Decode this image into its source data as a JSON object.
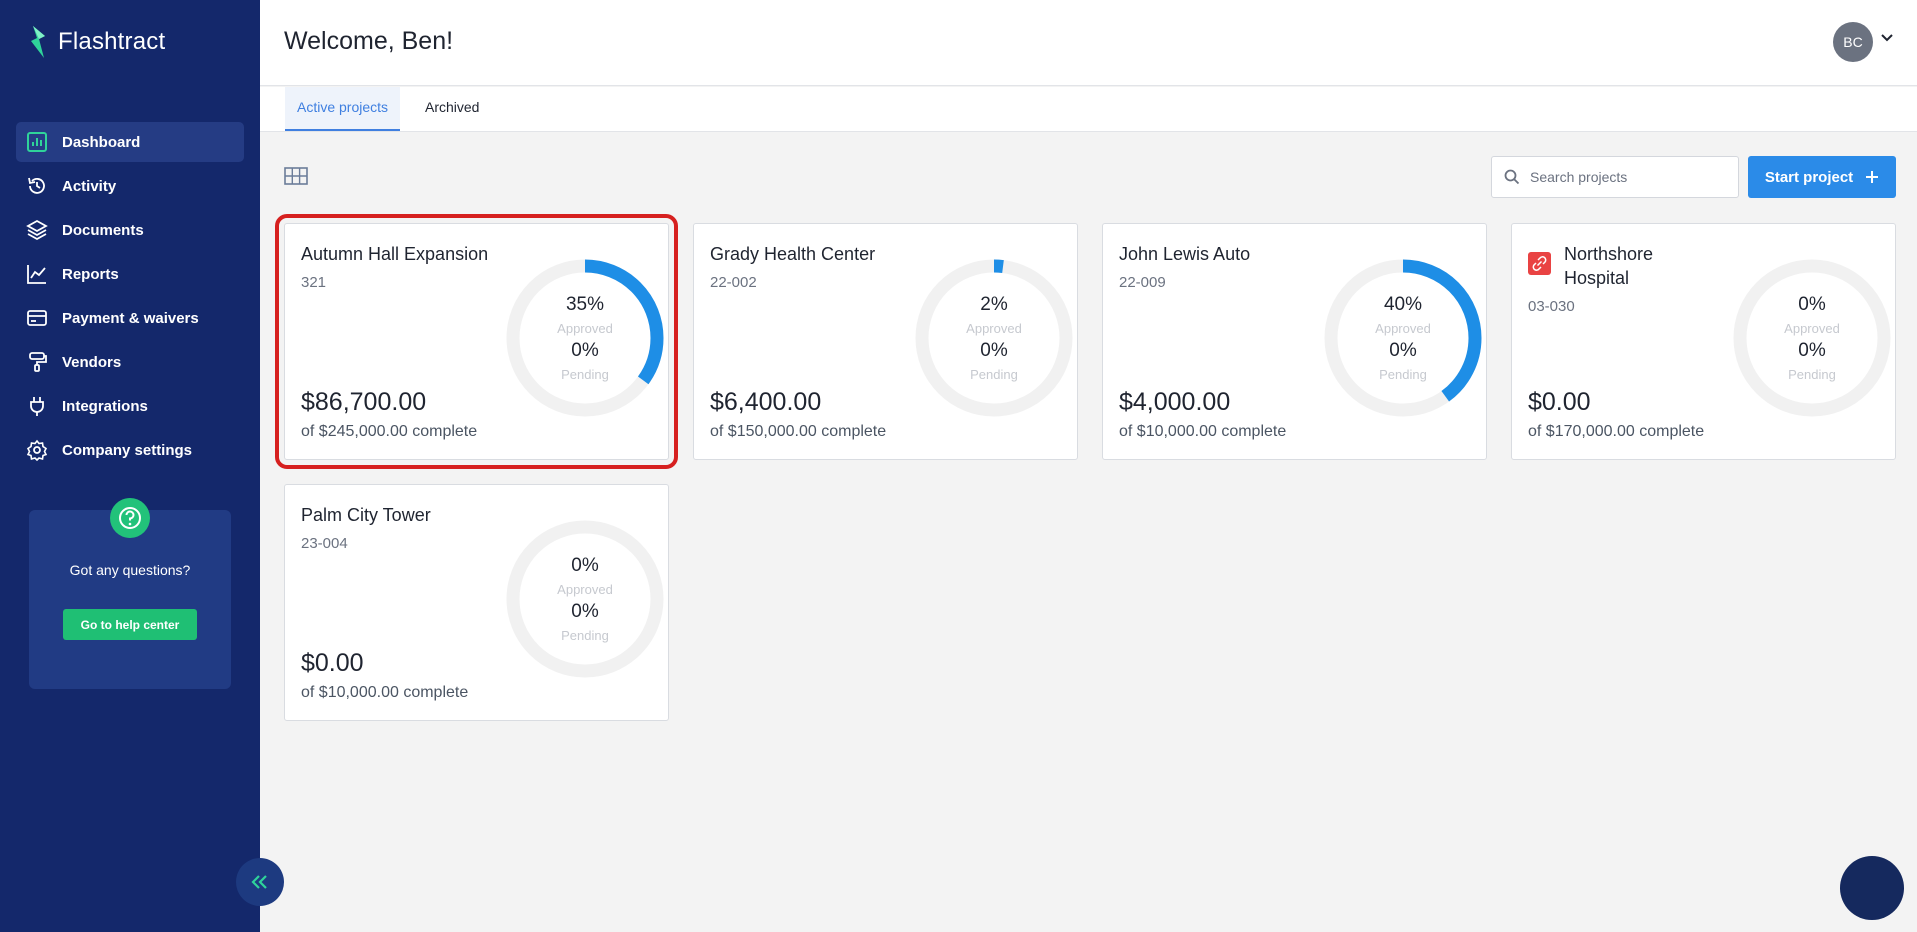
{
  "app": {
    "name": "Flashtract"
  },
  "sidebar": {
    "items": [
      {
        "label": "Dashboard",
        "icon": "chart-bar-icon",
        "active": true
      },
      {
        "label": "Activity",
        "icon": "history-icon",
        "active": false
      },
      {
        "label": "Documents",
        "icon": "layers-icon",
        "active": false
      },
      {
        "label": "Reports",
        "icon": "line-chart-icon",
        "active": false
      },
      {
        "label": "Payment & waivers",
        "icon": "credit-card-icon",
        "active": false
      },
      {
        "label": "Vendors",
        "icon": "brush-icon",
        "active": false
      },
      {
        "label": "Integrations",
        "icon": "plug-icon",
        "active": false
      },
      {
        "label": "Company settings",
        "icon": "gear-icon",
        "active": false
      }
    ],
    "help": {
      "text": "Got any questions?",
      "button": "Go to help center"
    }
  },
  "header": {
    "welcome": "Welcome, Ben!",
    "avatar_initials": "BC"
  },
  "tabs": [
    {
      "label": "Active projects",
      "active": true
    },
    {
      "label": "Archived",
      "active": false
    }
  ],
  "toolbar": {
    "search_placeholder": "Search projects",
    "start_label": "Start project"
  },
  "labels": {
    "approved": "Approved",
    "pending": "Pending"
  },
  "projects": [
    {
      "name": "Autumn Hall Expansion",
      "code": "321",
      "amount": "$86,700.00",
      "of": "of $245,000.00 complete",
      "approved_pct": 35,
      "approved": "35%",
      "pending": "0%",
      "selected": true
    },
    {
      "name": "Grady Health Center",
      "code": "22-002",
      "amount": "$6,400.00",
      "of": "of $150,000.00 complete",
      "approved_pct": 2,
      "approved": "2%",
      "pending": "0%"
    },
    {
      "name": "John Lewis Auto",
      "code": "22-009",
      "amount": "$4,000.00",
      "of": "of $10,000.00 complete",
      "approved_pct": 40,
      "approved": "40%",
      "pending": "0%"
    },
    {
      "name": "Northshore Hospital",
      "code": "03-030",
      "amount": "$0.00",
      "of": "of $170,000.00 complete",
      "approved_pct": 0,
      "approved": "0%",
      "pending": "0%",
      "has_icon": true
    },
    {
      "name": "Palm City Tower",
      "code": "23-004",
      "amount": "$0.00",
      "of": "of $10,000.00 complete",
      "approved_pct": 0,
      "approved": "0%",
      "pending": "0%"
    }
  ],
  "colors": {
    "sidebar": "#14286b",
    "accent": "#2b8be8",
    "success": "#1fbf74",
    "highlight": "#d6201f"
  }
}
